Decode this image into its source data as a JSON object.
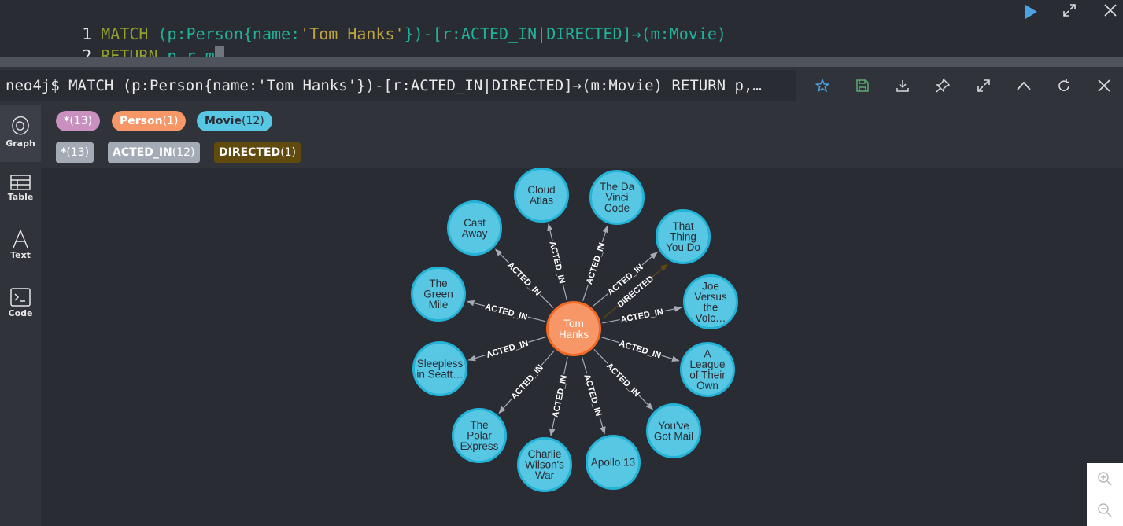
{
  "editor": {
    "lines": [
      {
        "number": "1",
        "tokens": [
          {
            "t": "MATCH ",
            "c": "kw"
          },
          {
            "t": "(p:Person{name:",
            "c": "p"
          },
          {
            "t": "'Tom Hanks'",
            "c": "str"
          },
          {
            "t": "})-[r:ACTED_IN|DIRECTED]→(m:Movie)",
            "c": "p"
          }
        ]
      },
      {
        "number": "2",
        "tokens": [
          {
            "t": "RETURN ",
            "c": "kw"
          },
          {
            "t": "p,r,m",
            "c": "p"
          }
        ]
      }
    ]
  },
  "frame": {
    "query": "neo4j$ MATCH (p:Person{name:'Tom Hanks'})-[r:ACTED_IN|DIRECTED]→(m:Movie) RETURN p,…"
  },
  "sidebar": {
    "items": [
      {
        "label": "Graph",
        "icon": "graph-icon"
      },
      {
        "label": "Table",
        "icon": "table-icon"
      },
      {
        "label": "Text",
        "icon": "text-icon"
      },
      {
        "label": "Code",
        "icon": "code-icon"
      }
    ]
  },
  "legend": {
    "node_labels": [
      {
        "name": "*",
        "count": "(13)",
        "color": "#c990c0",
        "text_color": "#ffffff"
      },
      {
        "name": "Person",
        "count": "(1)",
        "color": "#f79767",
        "text_color": "#ffffff"
      },
      {
        "name": "Movie",
        "count": "(12)",
        "color": "#57c7e3",
        "text_color": "#2a2c34"
      }
    ],
    "rel_types": [
      {
        "name": "*",
        "count": "(13)",
        "color": "#a5abb6",
        "text_color": "#ffffff"
      },
      {
        "name": "ACTED_IN",
        "count": "(12)",
        "color": "#a5abb6",
        "text_color": "#ffffff"
      },
      {
        "name": "DIRECTED",
        "count": "(1)",
        "color": "#604a0e",
        "text_color": "#ffffff"
      }
    ]
  },
  "graph": {
    "center": {
      "label": "Tom Hanks",
      "color": "#f79767",
      "border": "#f36924"
    },
    "movie_color": "#57c7e3",
    "movie_border": "#23b3d7",
    "nodes": [
      {
        "label": "Cloud Atlas",
        "lines": [
          "Cloud",
          "Atlas"
        ]
      },
      {
        "label": "The Da Vinci Code",
        "lines": [
          "The Da",
          "Vinci",
          "Code"
        ]
      },
      {
        "label": "That Thing You Do",
        "lines": [
          "That",
          "Thing",
          "You Do"
        ]
      },
      {
        "label": "Joe Versus the Volc…",
        "lines": [
          "Joe",
          "Versus",
          "the",
          "Volc…"
        ]
      },
      {
        "label": "A League of Their Own",
        "lines": [
          "A",
          "League",
          "of Their",
          "Own"
        ]
      },
      {
        "label": "You've Got Mail",
        "lines": [
          "You've",
          "Got Mail"
        ]
      },
      {
        "label": "Apollo 13",
        "lines": [
          "Apollo 13"
        ]
      },
      {
        "label": "Charlie Wilson's War",
        "lines": [
          "Charlie",
          "Wilson's",
          "War"
        ]
      },
      {
        "label": "The Polar Express",
        "lines": [
          "The",
          "Polar",
          "Express"
        ]
      },
      {
        "label": "Sleepless in Seatt…",
        "lines": [
          "Sleepless",
          "in Seatt…"
        ]
      },
      {
        "label": "The Green Mile",
        "lines": [
          "The",
          "Green",
          "Mile"
        ]
      },
      {
        "label": "Cast Away",
        "lines": [
          "Cast",
          "Away"
        ]
      }
    ],
    "relationships": [
      {
        "type": "ACTED_IN",
        "target": "Cloud Atlas"
      },
      {
        "type": "ACTED_IN",
        "target": "The Da Vinci Code"
      },
      {
        "type": "ACTED_IN",
        "target": "That Thing You Do"
      },
      {
        "type": "DIRECTED",
        "target": "That Thing You Do"
      },
      {
        "type": "ACTED_IN",
        "target": "Joe Versus the Volc…"
      },
      {
        "type": "ACTED_IN",
        "target": "A League of Their Own"
      },
      {
        "type": "ACTED_IN",
        "target": "You've Got Mail"
      },
      {
        "type": "ACTED_IN",
        "target": "Apollo 13"
      },
      {
        "type": "ACTED_IN",
        "target": "Charlie Wilson's War"
      },
      {
        "type": "ACTED_IN",
        "target": "The Polar Express"
      },
      {
        "type": "ACTED_IN",
        "target": "Sleepless in Seatt…"
      },
      {
        "type": "ACTED_IN",
        "target": "The Green Mile"
      },
      {
        "type": "ACTED_IN",
        "target": "Cast Away"
      }
    ],
    "acted_in_color": "#a5abb6",
    "directed_color": "#604a0e"
  },
  "colors": {
    "accent": "#4ba3e2",
    "icon": "#d8dadc",
    "save_icon": "#5aab72"
  },
  "icons": {
    "run": "play-icon",
    "fullscreen": "expand-icon",
    "close": "close-icon",
    "favorite": "star-icon",
    "save": "save-icon",
    "download": "download-icon",
    "pin": "pin-icon",
    "collapse": "chevron-up-icon",
    "rerun": "refresh-icon",
    "zoom_in": "zoom-in-icon",
    "zoom_out": "zoom-out-icon"
  }
}
